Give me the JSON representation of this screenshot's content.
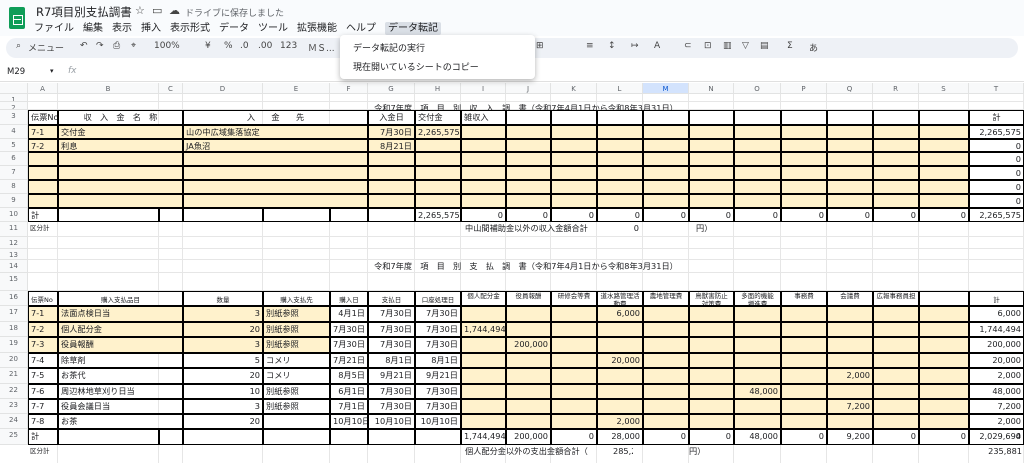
{
  "app": {
    "title": "R7項目別支払調書",
    "saved_status": "ドライブに保存しました",
    "menus": [
      "ファイル",
      "編集",
      "表示",
      "挿入",
      "表示形式",
      "データ",
      "ツール",
      "拡張機能",
      "ヘルプ",
      "データ転記"
    ],
    "active_menu": "データ転記"
  },
  "toolbar": {
    "menu_search": "メニュー",
    "zoom": "100%",
    "currency": "¥",
    "percent": "%",
    "dec_decrease": ".0",
    "dec_increase": ".00",
    "number_format": "123",
    "font": "ＭＳ...",
    "functions": "Σ",
    "input_tools": "あ"
  },
  "formula_bar": {
    "cell_ref": "M29",
    "fx": "fx",
    "value": ""
  },
  "dropdown": {
    "items": [
      "データ転記の実行",
      "現在開いているシートのコピー"
    ]
  },
  "sheet": {
    "columns": [
      "A",
      "B",
      "C",
      "D",
      "E",
      "F",
      "G",
      "H",
      "I",
      "J",
      "K",
      "L",
      "M",
      "N",
      "O",
      "P",
      "Q",
      "R",
      "S",
      "T"
    ],
    "selected_column": "M",
    "selected_row": "",
    "rows": [
      "1",
      "2",
      "3",
      "4",
      "5",
      "6",
      "7",
      "8",
      "9",
      "10",
      "11",
      "12",
      "13",
      "14",
      "15",
      "16",
      "17",
      "18",
      "19",
      "20",
      "21",
      "22",
      "23",
      "24",
      "25"
    ],
    "income_title": "令和7年度　項　目　別　収　入　調　書（令和7年4月1日から令和8年3月31日）",
    "income_headers": {
      "no": "伝票No",
      "name": "収　入　金　名　称",
      "payer": "入　　金　　先",
      "date": "入金日",
      "grant": "交付金",
      "misc": "雑収入",
      "total": "計"
    },
    "income_rows": [
      {
        "no": "7-1",
        "name": "交付金",
        "payer": "山の中広域集落協定",
        "date": "7月30日",
        "grant": "2,265,575",
        "misc": "",
        "total": "2,265,575"
      },
      {
        "no": "7-2",
        "name": "利息",
        "payer": "JA魚沼",
        "date": "8月21日",
        "grant": "",
        "misc": "",
        "total": "0"
      },
      {
        "no": "",
        "name": "",
        "payer": "",
        "date": "",
        "grant": "",
        "misc": "",
        "total": "0"
      },
      {
        "no": "",
        "name": "",
        "payer": "",
        "date": "",
        "grant": "",
        "misc": "",
        "total": "0"
      },
      {
        "no": "",
        "name": "",
        "payer": "",
        "date": "",
        "grant": "",
        "misc": "",
        "total": "0"
      },
      {
        "no": "",
        "name": "",
        "payer": "",
        "date": "",
        "grant": "",
        "misc": "",
        "total": "0"
      }
    ],
    "income_total": {
      "label": "計",
      "grant": "2,265,575",
      "zeros": [
        "0",
        "0",
        "0",
        "0",
        "0",
        "0",
        "0",
        "0",
        "0",
        "0",
        "0"
      ],
      "total": "2,265,575"
    },
    "income_sub": {
      "label": "区分計",
      "note": "中山間補助金以外の収入金額合計",
      "amount": "0",
      "unit": "円）"
    },
    "pay_title": "令和7年度　項　目　別　支　払　調　書（令和7年4月1日から令和8年3月31日）",
    "pay_headers": {
      "no": "伝票No",
      "item": "購入支払品目",
      "qty": "数量",
      "vendor": "購入支払先",
      "buy": "購入日",
      "paid": "支払日",
      "proc": "口座処理日",
      "cats": [
        "個人配分金",
        "役員報酬",
        "研修会等費",
        "道水路管理活\n動費",
        "農地管理費",
        "鳥獣害防止\n対策費",
        "多面的機能\n増進費",
        "事務費",
        "会議費",
        "広報事務員担"
      ],
      "total": "計"
    },
    "pay_rows": [
      {
        "no": "7-1",
        "item": "法面点検日当",
        "qty": "3",
        "vendor": "別紙参照",
        "buy": "4月1日",
        "paid": "7月30日",
        "proc": "7月30日",
        "cats": [
          "",
          "",
          "",
          "6,000",
          "",
          "",
          "",
          "",
          "",
          ""
        ],
        "total": "6,000"
      },
      {
        "no": "7-2",
        "item": "個人配分金",
        "qty": "20",
        "vendor": "別紙参照",
        "buy": "7月30日",
        "paid": "7月30日",
        "proc": "7月30日",
        "cats": [
          "1,744,494",
          "",
          "",
          "",
          "",
          "",
          "",
          "",
          "",
          ""
        ],
        "total": "1,744,494"
      },
      {
        "no": "7-3",
        "item": "役員報酬",
        "qty": "3",
        "vendor": "別紙参照",
        "buy": "7月30日",
        "paid": "7月30日",
        "proc": "7月30日",
        "cats": [
          "",
          "200,000",
          "",
          "",
          "",
          "",
          "",
          "",
          "",
          ""
        ],
        "total": "200,000"
      },
      {
        "no": "7-4",
        "item": "除草剤",
        "qty": "5",
        "vendor": "コメリ",
        "buy": "7月21日",
        "paid": "8月1日",
        "proc": "8月1日",
        "cats": [
          "",
          "",
          "",
          "20,000",
          "",
          "",
          "",
          "",
          "",
          ""
        ],
        "total": "20,000"
      },
      {
        "no": "7-5",
        "item": "お茶代",
        "qty": "20",
        "vendor": "コメリ",
        "buy": "8月5日",
        "paid": "9月21日",
        "proc": "9月21日",
        "cats": [
          "",
          "",
          "",
          "",
          "",
          "",
          "",
          "",
          "2,000",
          ""
        ],
        "total": "2,000"
      },
      {
        "no": "7-6",
        "item": "周辺林地草刈り日当",
        "qty": "10",
        "vendor": "別紙参照",
        "buy": "6月1日",
        "paid": "7月30日",
        "proc": "7月30日",
        "cats": [
          "",
          "",
          "",
          "",
          "",
          "",
          "48,000",
          "",
          "",
          ""
        ],
        "total": "48,000"
      },
      {
        "no": "7-7",
        "item": "役員会議日当",
        "qty": "3",
        "vendor": "別紙参照",
        "buy": "7月1日",
        "paid": "7月30日",
        "proc": "7月30日",
        "cats": [
          "",
          "",
          "",
          "",
          "",
          "",
          "",
          "",
          "7,200",
          ""
        ],
        "total": "7,200"
      },
      {
        "no": "7-8",
        "item": "お茶",
        "qty": "20",
        "vendor": "",
        "buy": "10月10日",
        "paid": "10月10日",
        "proc": "10月10日",
        "cats": [
          "",
          "",
          "",
          "2,000",
          "",
          "",
          "",
          "",
          "",
          ""
        ],
        "total": "2,000"
      }
    ],
    "pay_total": {
      "label": "計",
      "cats": [
        "1,744,494",
        "200,000",
        "0",
        "28,000",
        "0",
        "0",
        "48,000",
        "0",
        "9,200",
        "0",
        "0",
        "0"
      ],
      "total": "2,029,694"
    },
    "pay_sub": {
      "label": "区分計",
      "note": "個人配分金以外の支出金額合計（",
      "amount": "285,200",
      "unit": "円）",
      "total": "235,881"
    }
  },
  "colors": {
    "yellow": "#fff2cc",
    "selected_header": "#d3e3fd",
    "logo": "#0f9d58"
  }
}
